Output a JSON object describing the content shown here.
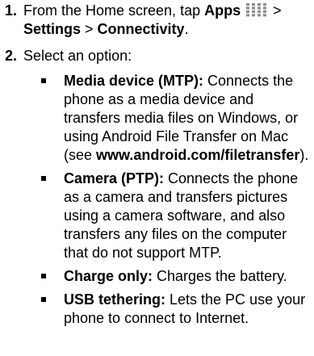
{
  "step1": {
    "number": "1.",
    "lead": "From the Home screen, tap ",
    "apps": "Apps",
    "icon": "apps-grid-icon",
    "sep1": " >",
    "settings": "Settings",
    "sep2": " > ",
    "connectivity": "Connectivity",
    "end": "."
  },
  "step2": {
    "number": "2.",
    "text": "Select an option:"
  },
  "options": [
    {
      "term": "Media device (MTP):",
      "desc": " Connects the phone as a media device and transfers media files on Windows, or using Android File Transfer on Mac (see ",
      "link": "www.android.com/filetransfer",
      "after": ")."
    },
    {
      "term": "Camera (PTP):",
      "desc": " Connects the phone as a camera and transfers pictures using a camera software, and also transfers any files on the computer that do not support MTP."
    },
    {
      "term": "Charge only:",
      "desc": " Charges the battery."
    },
    {
      "term": "USB tethering:",
      "desc": " Lets the PC use your phone to connect to Internet."
    }
  ]
}
